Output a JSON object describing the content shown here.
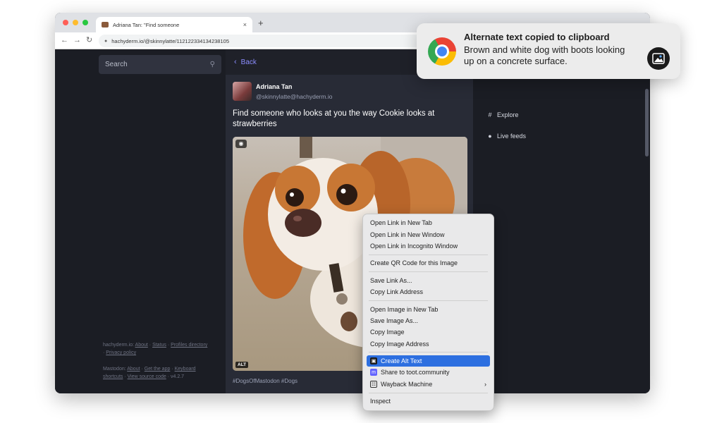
{
  "browser": {
    "tab_title": "Adriana Tan: \"Find someone",
    "tab_close": "×",
    "new_tab": "+",
    "url": "hachyderm.io/@skinnylatte/112122334134238105",
    "lock_icon": "lock-icon",
    "traffic_colors": [
      "#ff5f57",
      "#febc2e",
      "#28c840"
    ]
  },
  "sidebar": {
    "search_placeholder": "Search",
    "footer_line1_prefix": "hachyderm.io:",
    "footer_line1_links": [
      "About",
      "Status",
      "Profiles directory",
      "Privacy policy"
    ],
    "footer_line2_prefix": "Mastodon:",
    "footer_line2_links": [
      "About",
      "Get the app",
      "Keyboard shortcuts",
      "View source code"
    ],
    "footer_version": "v4.2.7"
  },
  "column": {
    "back_label": "Back",
    "author_name": "Adriana Tan",
    "author_handle": "@skinnylatte@hachyderm.io",
    "post_text": "Find someone who looks at you the way Cookie looks at strawberries",
    "alt_badge": "ALT",
    "hashtags": "#DogsOfMastodon #Dogs"
  },
  "right_nav": {
    "items": [
      {
        "label": "Explore",
        "icon": "hashtag-icon"
      },
      {
        "label": "Live feeds",
        "icon": "globe-icon"
      }
    ]
  },
  "context_menu": {
    "groups": [
      [
        "Open Link in New Tab",
        "Open Link in New Window",
        "Open Link in Incognito Window"
      ],
      [
        "Create QR Code for this Image"
      ],
      [
        "Save Link As...",
        "Copy Link Address"
      ],
      [
        "Open Image in New Tab",
        "Save Image As...",
        "Copy Image",
        "Copy Image Address"
      ],
      [
        "Create Alt Text",
        "Share to toot.community",
        "Wayback Machine"
      ],
      [
        "Inspect"
      ]
    ],
    "highlighted": "Create Alt Text",
    "highlight_color": "#2d6fe0"
  },
  "notification": {
    "title": "Alternate text copied to clipboard",
    "body": "Brown and white dog with boots looking up on a concrete surface.",
    "app_icon": "chrome-icon"
  },
  "colors": {
    "mastodon_link": "#8c8dff",
    "dark_bg": "#1b1d24",
    "column_bg": "#282b36"
  }
}
